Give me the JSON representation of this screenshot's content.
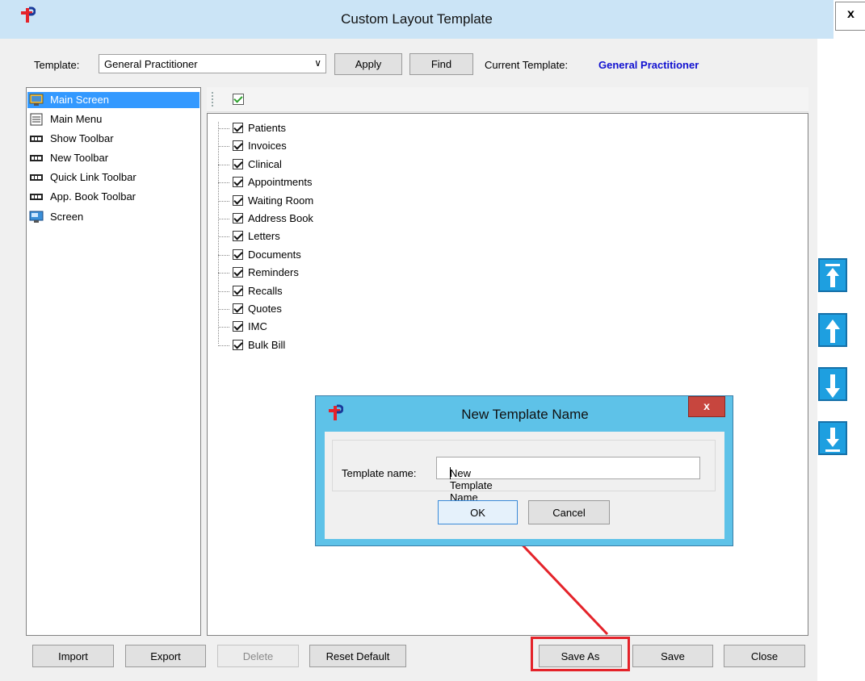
{
  "window": {
    "title": "Custom Layout Template",
    "close_label": "x"
  },
  "colors": {
    "accent": "#1010d0",
    "highlight": "#e4232a",
    "dialog_frame": "#5ec2e8",
    "selection": "#3399ff",
    "arrow_buttons": "#1e9fe0"
  },
  "toolbar": {
    "template_label": "Template:",
    "template_value": "General Practitioner",
    "apply_label": "Apply",
    "find_label": "Find",
    "current_template_label": "Current Template:",
    "current_template_value": "General Practitioner"
  },
  "left_list": {
    "items": [
      {
        "label": "Main Screen",
        "icon": "monitor-icon",
        "selected": true
      },
      {
        "label": "Main Menu",
        "icon": "menu-icon"
      },
      {
        "label": "Show Toolbar",
        "icon": "toolbar-icon"
      },
      {
        "label": "New Toolbar",
        "icon": "toolbar-icon"
      },
      {
        "label": "Quick Link Toolbar",
        "icon": "toolbar-icon"
      },
      {
        "label": "App. Book Toolbar",
        "icon": "toolbar-icon"
      },
      {
        "label": "Screen",
        "icon": "screen-icon"
      }
    ]
  },
  "tree": {
    "items": [
      "Patients",
      "Invoices",
      "Clinical",
      "Appointments",
      "Waiting Room",
      "Address Book",
      "Letters",
      "Documents",
      "Reminders",
      "Recalls",
      "Quotes",
      "IMC",
      "Bulk Bill"
    ]
  },
  "side_buttons": [
    "move-top-icon",
    "move-up-icon",
    "move-down-icon",
    "move-bottom-icon"
  ],
  "bottom": {
    "import_label": "Import",
    "export_label": "Export",
    "delete_label": "Delete",
    "reset_label": "Reset Default",
    "save_as_label": "Save As",
    "save_label": "Save",
    "close_label": "Close"
  },
  "dialog": {
    "title": "New Template Name",
    "close_label": "x",
    "field_label": "Template name:",
    "field_value": "New Template Name",
    "ok_label": "OK",
    "cancel_label": "Cancel"
  }
}
